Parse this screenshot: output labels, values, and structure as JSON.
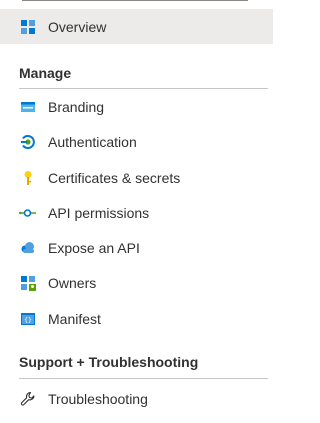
{
  "overview": {
    "label": "Overview",
    "icon": "overview-grid-icon"
  },
  "sections": [
    {
      "title": "Manage",
      "items": [
        {
          "label": "Branding",
          "icon": "branding-icon"
        },
        {
          "label": "Authentication",
          "icon": "authentication-icon"
        },
        {
          "label": "Certificates & secrets",
          "icon": "key-icon"
        },
        {
          "label": "API permissions",
          "icon": "api-permissions-icon"
        },
        {
          "label": "Expose an API",
          "icon": "cloud-icon"
        },
        {
          "label": "Owners",
          "icon": "owners-icon"
        },
        {
          "label": "Manifest",
          "icon": "manifest-icon"
        }
      ]
    },
    {
      "title": "Support + Troubleshooting",
      "items": [
        {
          "label": "Troubleshooting",
          "icon": "wrench-icon"
        }
      ]
    }
  ],
  "colors": {
    "selected_bg": "#edebe9",
    "accent_blue": "#0078d4",
    "key_yellow": "#fcd116",
    "green": "#57a300",
    "text": "#323130"
  }
}
